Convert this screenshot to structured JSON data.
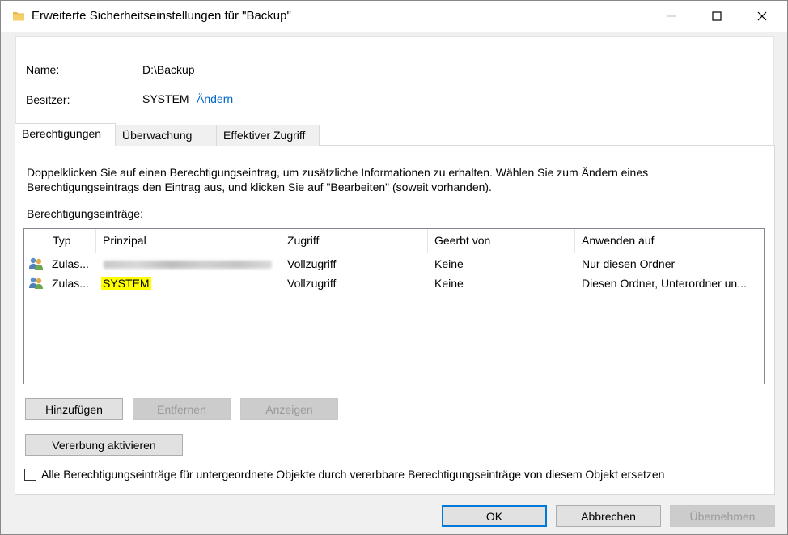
{
  "window": {
    "title": "Erweiterte Sicherheitseinstellungen für \"Backup\"",
    "icon": "folder-icon"
  },
  "info": {
    "name_label": "Name:",
    "name_value": "D:\\Backup",
    "owner_label": "Besitzer:",
    "owner_value": "SYSTEM",
    "owner_change_link": "Ändern"
  },
  "tabs": [
    {
      "label": "Berechtigungen",
      "active": true
    },
    {
      "label": "Überwachung",
      "active": false
    },
    {
      "label": "Effektiver Zugriff",
      "active": false
    }
  ],
  "permissions": {
    "description": "Doppelklicken Sie auf einen Berechtigungseintrag, um zusätzliche Informationen zu erhalten. Wählen Sie zum Ändern eines Berechtigungseintrags den Eintrag aus, und klicken Sie auf \"Bearbeiten\" (soweit vorhanden).",
    "entries_label": "Berechtigungseinträge:",
    "columns": [
      "Typ",
      "Prinzipal",
      "Zugriff",
      "Geerbt von",
      "Anwenden auf"
    ],
    "rows": [
      {
        "type": "Zulas...",
        "principal": "",
        "principal_redacted": true,
        "access": "Vollzugriff",
        "inherited": "Keine",
        "applies": "Nur diesen Ordner"
      },
      {
        "type": "Zulas...",
        "principal": "SYSTEM",
        "principal_redacted": false,
        "access": "Vollzugriff",
        "inherited": "Keine",
        "applies": "Diesen Ordner, Unterordner un..."
      }
    ],
    "add_button": "Hinzufügen",
    "remove_button": "Entfernen",
    "view_button": "Anzeigen",
    "inheritance_button": "Vererbung aktivieren",
    "replace_checkbox_label": "Alle Berechtigungseinträge für untergeordnete Objekte durch vererbbare Berechtigungseinträge von diesem Objekt ersetzen",
    "replace_checked": false
  },
  "footer": {
    "ok": "OK",
    "cancel": "Abbrechen",
    "apply": "Übernehmen"
  },
  "colors": {
    "link": "#0066cc",
    "highlight": "#ffff00",
    "focus_border": "#0078d7"
  }
}
